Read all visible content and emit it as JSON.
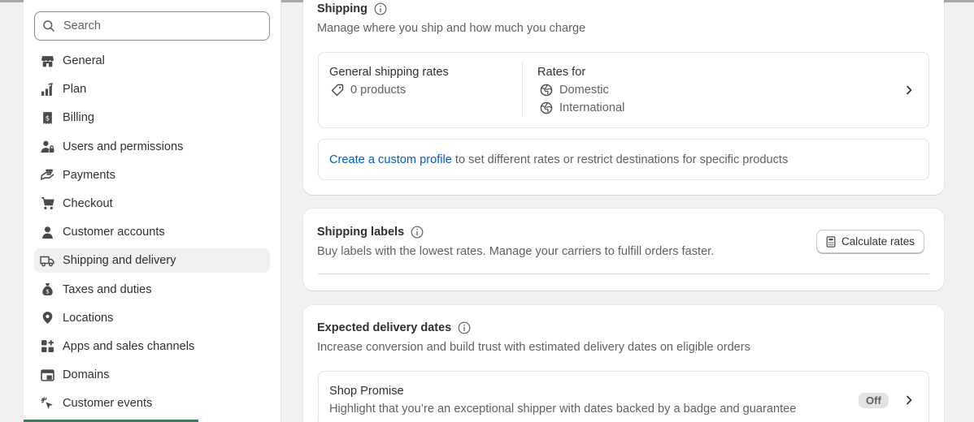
{
  "search": {
    "placeholder": "Search"
  },
  "sidebar": {
    "items": [
      {
        "label": "General",
        "icon": "store-icon"
      },
      {
        "label": "Plan",
        "icon": "plan-icon"
      },
      {
        "label": "Billing",
        "icon": "receipt-icon"
      },
      {
        "label": "Users and permissions",
        "icon": "users-icon"
      },
      {
        "label": "Payments",
        "icon": "payments-icon"
      },
      {
        "label": "Checkout",
        "icon": "cart-icon"
      },
      {
        "label": "Customer accounts",
        "icon": "person-icon"
      },
      {
        "label": "Shipping and delivery",
        "icon": "truck-icon",
        "active": true
      },
      {
        "label": "Taxes and duties",
        "icon": "money-bag-icon"
      },
      {
        "label": "Locations",
        "icon": "location-pin-icon"
      },
      {
        "label": "Apps and sales channels",
        "icon": "apps-icon"
      },
      {
        "label": "Domains",
        "icon": "domains-icon"
      },
      {
        "label": "Customer events",
        "icon": "cursor-click-icon"
      }
    ]
  },
  "shipping": {
    "title": "Shipping",
    "description": "Manage where you ship and how much you charge",
    "general_rates": {
      "title": "General shipping rates",
      "products": "0 products",
      "rates_for_label": "Rates for",
      "zones": [
        "Domestic",
        "International"
      ]
    },
    "custom_profile": {
      "link_text": "Create a custom profile",
      "rest_text": " to set different rates or restrict destinations for specific products"
    }
  },
  "shipping_labels": {
    "title": "Shipping labels",
    "description": "Buy labels with the lowest rates. Manage your carriers to fulfill orders faster.",
    "button_label": "Calculate rates"
  },
  "delivery_dates": {
    "title": "Expected delivery dates",
    "description": "Increase conversion and build trust with estimated delivery dates on eligible orders",
    "shop_promise": {
      "title": "Shop Promise",
      "description": "Highlight that you’re an exceptional shipper with dates backed by a badge and guarantee",
      "status": "Off"
    }
  },
  "colors": {
    "accent_link": "#005bd3",
    "status_green": "#29845a",
    "page_bg": "#f1f1f1"
  }
}
